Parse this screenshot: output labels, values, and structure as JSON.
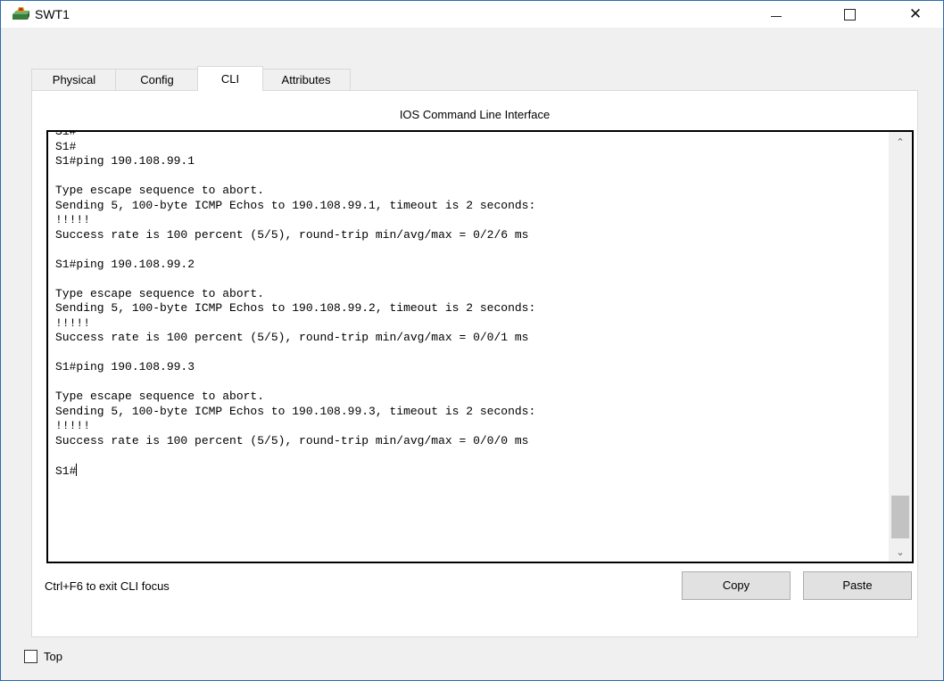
{
  "window": {
    "title": "SWT1",
    "icon": "switch-icon"
  },
  "controls": {
    "minimize_icon": "minimize-icon",
    "maximize_icon": "maximize-icon",
    "close_glyph": "✕"
  },
  "tabs": [
    {
      "label": "Physical"
    },
    {
      "label": "Config"
    },
    {
      "label": "CLI"
    },
    {
      "label": "Attributes"
    }
  ],
  "active_tab": "CLI",
  "panel": {
    "header": "IOS Command Line Interface"
  },
  "console": {
    "text": "S1#\nS1#\nS1#ping 190.108.99.1\n\nType escape sequence to abort.\nSending 5, 100-byte ICMP Echos to 190.108.99.1, timeout is 2 seconds:\n!!!!!\nSuccess rate is 100 percent (5/5), round-trip min/avg/max = 0/2/6 ms\n\nS1#ping 190.108.99.2\n\nType escape sequence to abort.\nSending 5, 100-byte ICMP Echos to 190.108.99.2, timeout is 2 seconds:\n!!!!!\nSuccess rate is 100 percent (5/5), round-trip min/avg/max = 0/0/1 ms\n\nS1#ping 190.108.99.3\n\nType escape sequence to abort.\nSending 5, 100-byte ICMP Echos to 190.108.99.3, timeout is 2 seconds:\n!!!!!\nSuccess rate is 100 percent (5/5), round-trip min/avg/max = 0/0/0 ms\n\nS1#",
    "scroll_up_glyph": "⌃",
    "scroll_down_glyph": "⌄"
  },
  "footer": {
    "hint": "Ctrl+F6 to exit CLI focus",
    "copy_label": "Copy",
    "paste_label": "Paste"
  },
  "top_checkbox": {
    "label": "Top",
    "checked": false
  }
}
